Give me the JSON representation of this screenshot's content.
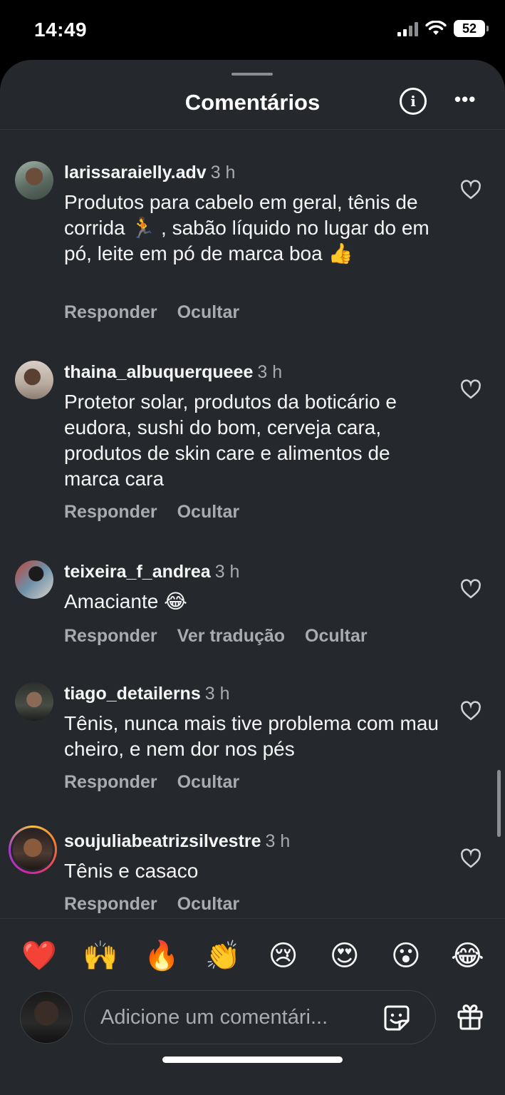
{
  "status_bar": {
    "time": "14:49",
    "battery": "52"
  },
  "header": {
    "title": "Comentários",
    "info_icon": "info-icon",
    "more_icon": "more-horizontal-icon"
  },
  "comments": [
    {
      "username": "larissaraielly.adv",
      "time": "3 h",
      "text": "Produtos para cabelo em geral, tênis de corrida 🏃 , sabão líquido no lugar do em pó, leite em pó de marca boa 👍",
      "actions": [
        "Responder",
        "Ocultar"
      ]
    },
    {
      "username": "thaina_albuquerqueee",
      "time": "3 h",
      "text": "Protetor solar, produtos da boticário e eudora, sushi do bom, cerveja cara, produtos de skin care e alimentos de marca cara",
      "actions": [
        "Responder",
        "Ocultar"
      ]
    },
    {
      "username": "teixeira_f_andrea",
      "time": "3 h",
      "text": "Amaciante 😂",
      "actions": [
        "Responder",
        "Ver tradução",
        "Ocultar"
      ]
    },
    {
      "username": "tiago_detailerns",
      "time": "3 h",
      "text": "Tênis, nunca mais tive problema com mau cheiro, e nem dor nos pés",
      "actions": [
        "Responder",
        "Ocultar"
      ]
    },
    {
      "username": "soujuliabeatrizsilvestre",
      "time": "3 h",
      "text": "Tênis e casaco",
      "actions": [
        "Responder",
        "Ocultar"
      ]
    }
  ],
  "reactions": [
    "❤️",
    "🙌",
    "🔥",
    "👏",
    "😢",
    "😍",
    "😮",
    "😂"
  ],
  "composer": {
    "placeholder": "Adicione um comentári..."
  }
}
